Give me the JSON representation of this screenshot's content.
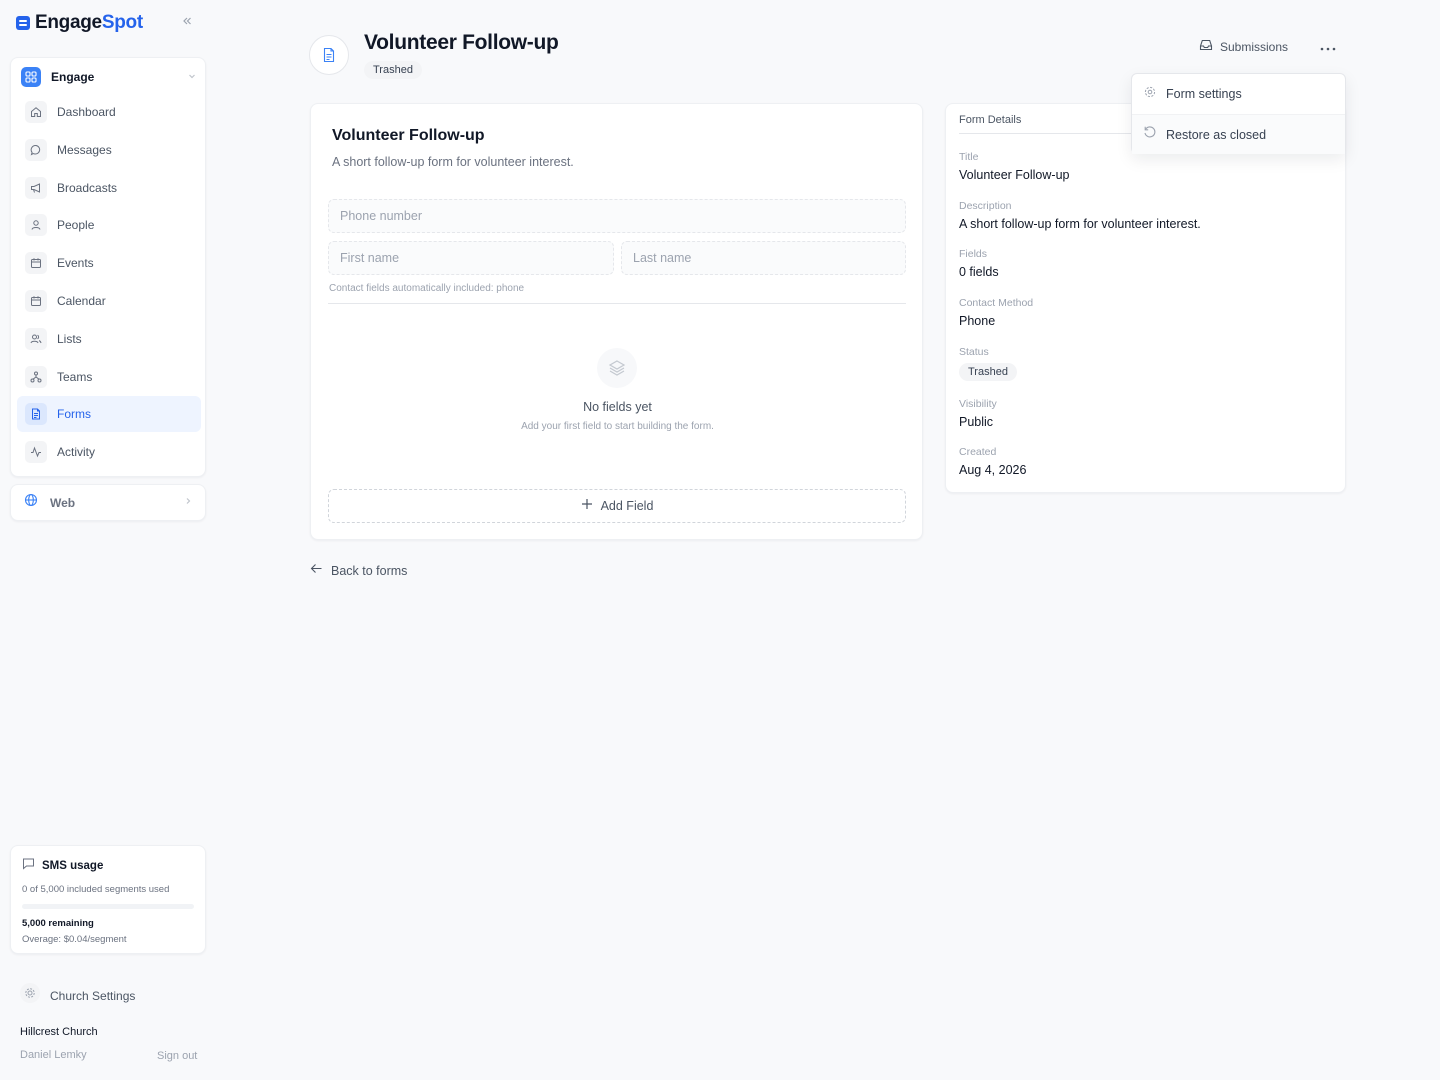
{
  "brand": {
    "name_part1": "Engage",
    "name_part2": "Spot"
  },
  "sidebar": {
    "group": {
      "label": "Engage"
    },
    "items": [
      {
        "label": "Dashboard",
        "icon": "home-icon"
      },
      {
        "label": "Messages",
        "icon": "message-icon"
      },
      {
        "label": "Broadcasts",
        "icon": "megaphone-icon"
      },
      {
        "label": "People",
        "icon": "person-icon"
      },
      {
        "label": "Events",
        "icon": "calendar-icon"
      },
      {
        "label": "Calendar",
        "icon": "calendar-icon"
      },
      {
        "label": "Lists",
        "icon": "users-icon"
      },
      {
        "label": "Teams",
        "icon": "network-icon"
      },
      {
        "label": "Forms",
        "icon": "document-icon",
        "active": true
      },
      {
        "label": "Activity",
        "icon": "activity-icon"
      }
    ],
    "web": {
      "label": "Web"
    },
    "sms": {
      "title": "SMS usage",
      "used_text": "0 of 5,000 included segments used",
      "used_fraction": 0,
      "remaining": "5,000 remaining",
      "overage": "Overage: $0.04/segment"
    },
    "settings_label": "Church Settings",
    "church": "Hillcrest Church",
    "user": "Daniel Lemky",
    "sign_out": "Sign out"
  },
  "header": {
    "title": "Volunteer Follow-up",
    "status": "Trashed",
    "submissions_label": "Submissions"
  },
  "menu": {
    "items": [
      {
        "label": "Form settings",
        "icon": "gear-icon"
      },
      {
        "label": "Restore as closed",
        "icon": "restore-icon"
      }
    ]
  },
  "form": {
    "title": "Volunteer Follow-up",
    "description": "A short follow-up form for volunteer interest.",
    "phone_placeholder": "Phone number",
    "first_name_placeholder": "First name",
    "last_name_placeholder": "Last name",
    "contact_note": "Contact fields automatically included: phone",
    "empty_title": "No fields yet",
    "empty_subtitle": "Add your first field to start building the form.",
    "add_field_label": "Add Field"
  },
  "back_label": "Back to forms",
  "details": {
    "header": "Form Details",
    "title_label": "Title",
    "title_value": "Volunteer Follow-up",
    "description_label": "Description",
    "description_value": "A short follow-up form for volunteer interest.",
    "fields_label": "Fields",
    "fields_value": "0 fields",
    "contact_label": "Contact Method",
    "contact_value": "Phone",
    "status_label": "Status",
    "status_value": "Trashed",
    "visibility_label": "Visibility",
    "visibility_value": "Public",
    "created_label": "Created",
    "created_value": "Aug 4, 2026"
  },
  "colors": {
    "accent": "#2563eb",
    "accent_soft": "#eef4ff"
  }
}
